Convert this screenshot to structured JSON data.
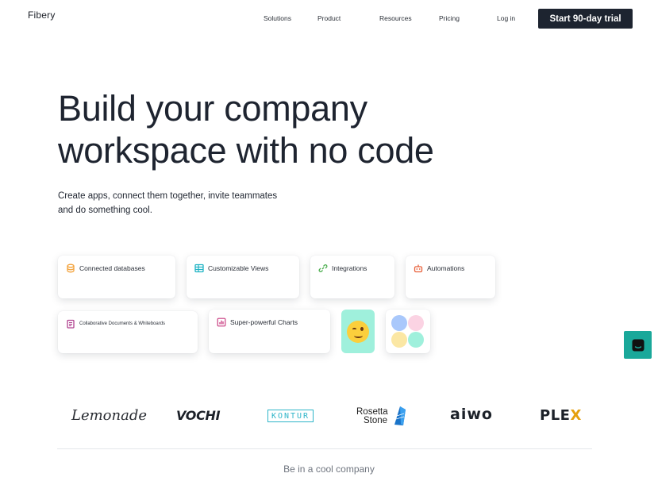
{
  "header": {
    "logo": "Fibery",
    "nav": [
      "Solutions",
      "Product",
      "Resources",
      "Pricing"
    ],
    "login": "Log in",
    "cta": "Start 90-day trial"
  },
  "hero": {
    "title_line1": "Build your company",
    "title_line2": "workspace with no code",
    "subtitle_line1": "Create apps, connect them together, invite teammates",
    "subtitle_line2": "and do something cool."
  },
  "features": [
    {
      "label": "Connected databases",
      "icon": "database-icon",
      "color": "#f3a23a"
    },
    {
      "label": "Customizable Views",
      "icon": "table-icon",
      "color": "#1fb3c4"
    },
    {
      "label": "Integrations",
      "icon": "link-icon",
      "color": "#4cae4f"
    },
    {
      "label": "Automations",
      "icon": "robot-icon",
      "color": "#e8603a"
    },
    {
      "label": "Collaborative Documents & Whiteboards",
      "icon": "document-icon",
      "color": "#b0418f"
    },
    {
      "label": "Super-powerful Charts",
      "icon": "chart-icon",
      "color": "#c93f82"
    }
  ],
  "decor": {
    "emoji": "winking-face-icon",
    "dot_colors": [
      "#a9c8fb",
      "#fbd3e3",
      "#fbe7a4",
      "#9ff0dc"
    ]
  },
  "brands": [
    "Lemonade",
    "VOCHI",
    "KONTUR",
    "Rosetta",
    "Stone",
    "aiwo",
    "PLE",
    "X"
  ],
  "footer": {
    "tagline": "Be in a cool company"
  },
  "colors": {
    "primary": "#1d2430",
    "chat": "#1aa89a",
    "emoji_tile": "#9ff0dc"
  }
}
